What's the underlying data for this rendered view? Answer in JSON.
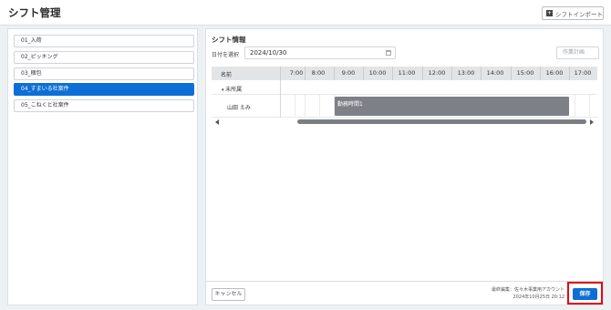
{
  "header": {
    "title": "シフト管理",
    "import_label": "シフトインポート"
  },
  "sidebar": {
    "items": [
      {
        "label": "01_入荷"
      },
      {
        "label": "02_ピッキング"
      },
      {
        "label": "03_梱包"
      },
      {
        "label": "04_すまいる社案件"
      },
      {
        "label": "05_こねくと社案件"
      }
    ],
    "active_index": 3
  },
  "main": {
    "section_title": "シフト情報",
    "date_label": "日付を選択",
    "date_value": "2024/10/30",
    "plan_button": "作業計画",
    "grid": {
      "name_header": "名前",
      "hours": [
        "7:00",
        "8:00",
        "9:00",
        "10:00",
        "11:00",
        "12:00",
        "13:00",
        "14:00",
        "15:00",
        "16:00",
        "17:00"
      ],
      "group_label": "未所属",
      "person_name": "山田 えみ",
      "shift_label": "勤務時間1"
    }
  },
  "footer": {
    "cancel_label": "キャンセル",
    "edited_by": "最終編集：佐々木事業用アカウント",
    "edited_at": "2024年10月25日 20:12",
    "save_label": "保存"
  },
  "colors": {
    "accent": "#0d6fd6",
    "highlight": "#e30613",
    "shift_bar": "#7d8086"
  }
}
